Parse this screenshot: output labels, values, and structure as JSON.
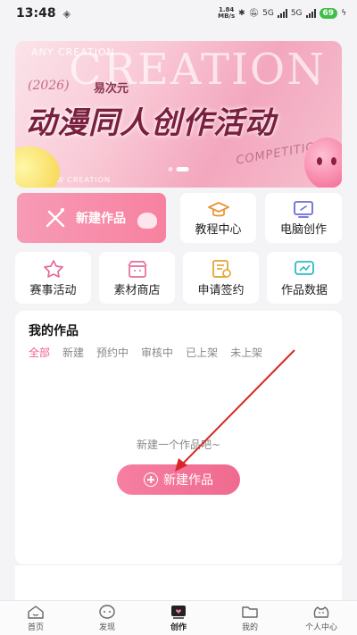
{
  "status_bar": {
    "time": "13:48",
    "net_speed_value": "1.84",
    "net_speed_unit": "MB/s",
    "signal_1_label": "5G",
    "signal_2_label": "5G",
    "battery": "69"
  },
  "banner": {
    "bg_text": "CREATION",
    "small_text": "ANY CREATION",
    "year": "(2026)",
    "brand": "易次元",
    "title": "动漫同人创作活动",
    "competition_text": "COMPETITION",
    "bottom_text": "ANY NEW CREATION",
    "slide_count": 2,
    "active_slide": 2
  },
  "quick_actions": {
    "new_work": "新建作品",
    "tutorial": "教程中心",
    "pc_create": "电脑创作",
    "events": "赛事活动",
    "materials": "素材商店",
    "sign_contract": "申请签约",
    "work_data": "作品数据"
  },
  "works": {
    "title": "我的作品",
    "tabs": [
      "全部",
      "新建",
      "预约中",
      "审核中",
      "已上架",
      "未上架"
    ],
    "active_tab": "全部",
    "empty_text": "新建一个作品吧~",
    "create_button": "新建作品"
  },
  "bottom_nav": {
    "items": [
      "首页",
      "发现",
      "创作",
      "我的",
      "个人中心"
    ],
    "active": "创作"
  },
  "colors": {
    "accent": "#f0618a",
    "annotation_arrow": "#d62828"
  }
}
